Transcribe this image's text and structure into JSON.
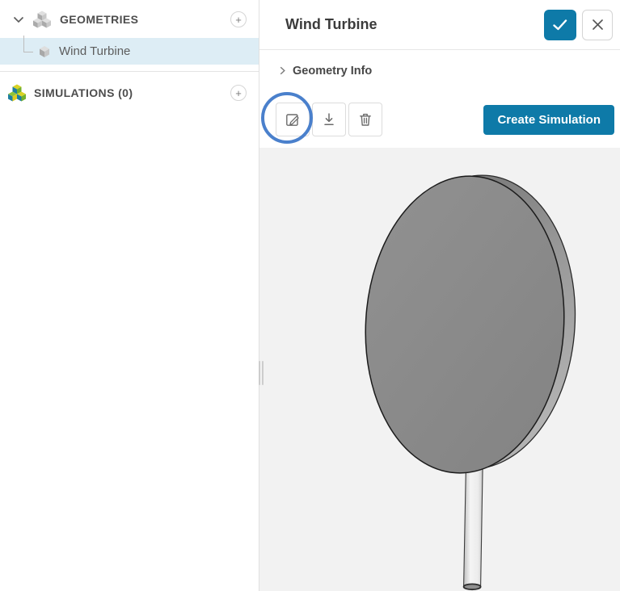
{
  "sidebar": {
    "geometries": {
      "label": "GEOMETRIES",
      "add_button": "+"
    },
    "geometry_items": [
      {
        "label": "Wind Turbine",
        "selected": true
      }
    ],
    "simulations": {
      "label": "SIMULATIONS (0)",
      "add_button": "+"
    }
  },
  "panel": {
    "title": "Wind Turbine",
    "geometry_info_label": "Geometry Info",
    "create_simulation_label": "Create Simulation",
    "icons": {
      "confirm": "check-icon",
      "close": "close-icon",
      "edit": "edit-pencil-icon",
      "download": "download-icon",
      "delete": "trash-icon"
    }
  },
  "viewport": {
    "object": "rotor disc with tower"
  },
  "colors": {
    "primary": "#0e7aa8",
    "annotation_circle": "#4a80cc",
    "selected_row": "#ddedf5",
    "viewport_bg": "#f2f2f2",
    "disc_face": "#8a8a8a",
    "disc_rim": "#9d9d9d"
  }
}
